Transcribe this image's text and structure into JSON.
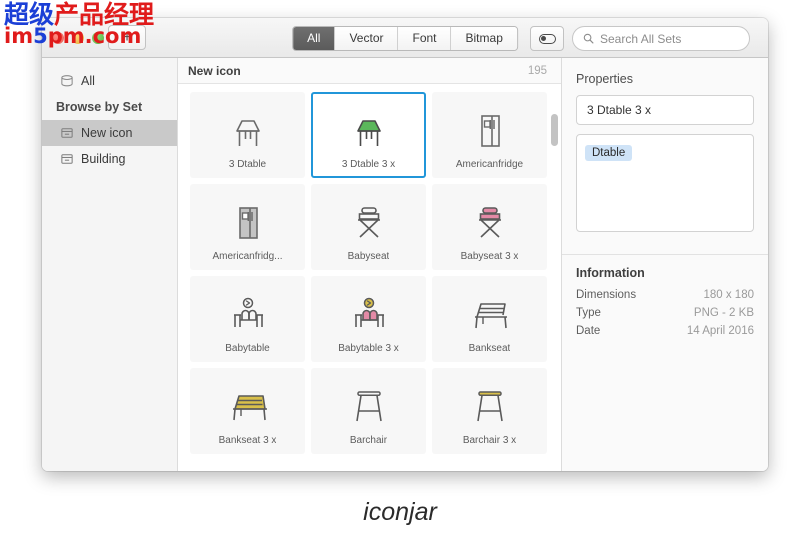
{
  "window": {
    "titlebar": {
      "add_button": "+",
      "traffic_lights": [
        "close-red",
        "minimize-yellow",
        "zoom-green"
      ],
      "segmented": [
        {
          "label": "All",
          "active": true
        },
        {
          "label": "Vector",
          "active": false
        },
        {
          "label": "Font",
          "active": false
        },
        {
          "label": "Bitmap",
          "active": false
        }
      ],
      "toggle_icon": "switch-toggle-icon",
      "search": {
        "placeholder": "Search All Sets",
        "value": "",
        "icon": "search-icon"
      }
    }
  },
  "sidebar": {
    "all_label": "All",
    "section_header": "Browse by Set",
    "items": [
      {
        "label": "New icon",
        "selected": true
      },
      {
        "label": "Building",
        "selected": false
      }
    ]
  },
  "grid": {
    "header_title": "New icon",
    "header_count": "195",
    "items": [
      {
        "label": "3 Dtable",
        "icon": "table-3d-outline-icon",
        "selected": false
      },
      {
        "label": "3 Dtable 3 x",
        "icon": "table-3d-green-icon",
        "selected": true
      },
      {
        "label": "Americanfridge",
        "icon": "fridge-outline-icon",
        "selected": false
      },
      {
        "label": "Americanfridg...",
        "icon": "fridge-filled-gray-icon",
        "selected": false
      },
      {
        "label": "Babyseat",
        "icon": "directors-chair-icon",
        "selected": false
      },
      {
        "label": "Babyseat 3 x",
        "icon": "directors-chair-pink-icon",
        "selected": false
      },
      {
        "label": "Babytable",
        "icon": "baby-table-outline-icon",
        "selected": false
      },
      {
        "label": "Babytable 3 x",
        "icon": "baby-table-pink-icon",
        "selected": false
      },
      {
        "label": "Bankseat",
        "icon": "bench-outline-icon",
        "selected": false
      },
      {
        "label": "Bankseat 3 x",
        "icon": "bench-yellow-icon",
        "selected": false
      },
      {
        "label": "Barchair",
        "icon": "bar-stool-outline-icon",
        "selected": false
      },
      {
        "label": "Barchair 3 x",
        "icon": "bar-stool-gold-icon",
        "selected": false
      }
    ]
  },
  "inspector": {
    "properties_title": "Properties",
    "name_value": "3 Dtable 3 x",
    "tags": [
      "Dtable"
    ],
    "information_title": "Information",
    "info_rows": [
      {
        "key": "Dimensions",
        "value": "180 x 180"
      },
      {
        "key": "Type",
        "value": "PNG - 2 KB"
      },
      {
        "key": "Date",
        "value": "14 April 2016"
      }
    ]
  },
  "caption": "iconjar",
  "watermark": {
    "cn_blue": "超级",
    "cn_red": "产品经理",
    "url_a": "im",
    "url_b": "5",
    "url_c": "pm.com"
  },
  "colors": {
    "selection_blue": "#2196d9",
    "tag_blue": "#cfe3f7",
    "green_icon": "#5bb75b",
    "pink_icon": "#e38aa6",
    "gold_icon": "#d9c04a"
  }
}
